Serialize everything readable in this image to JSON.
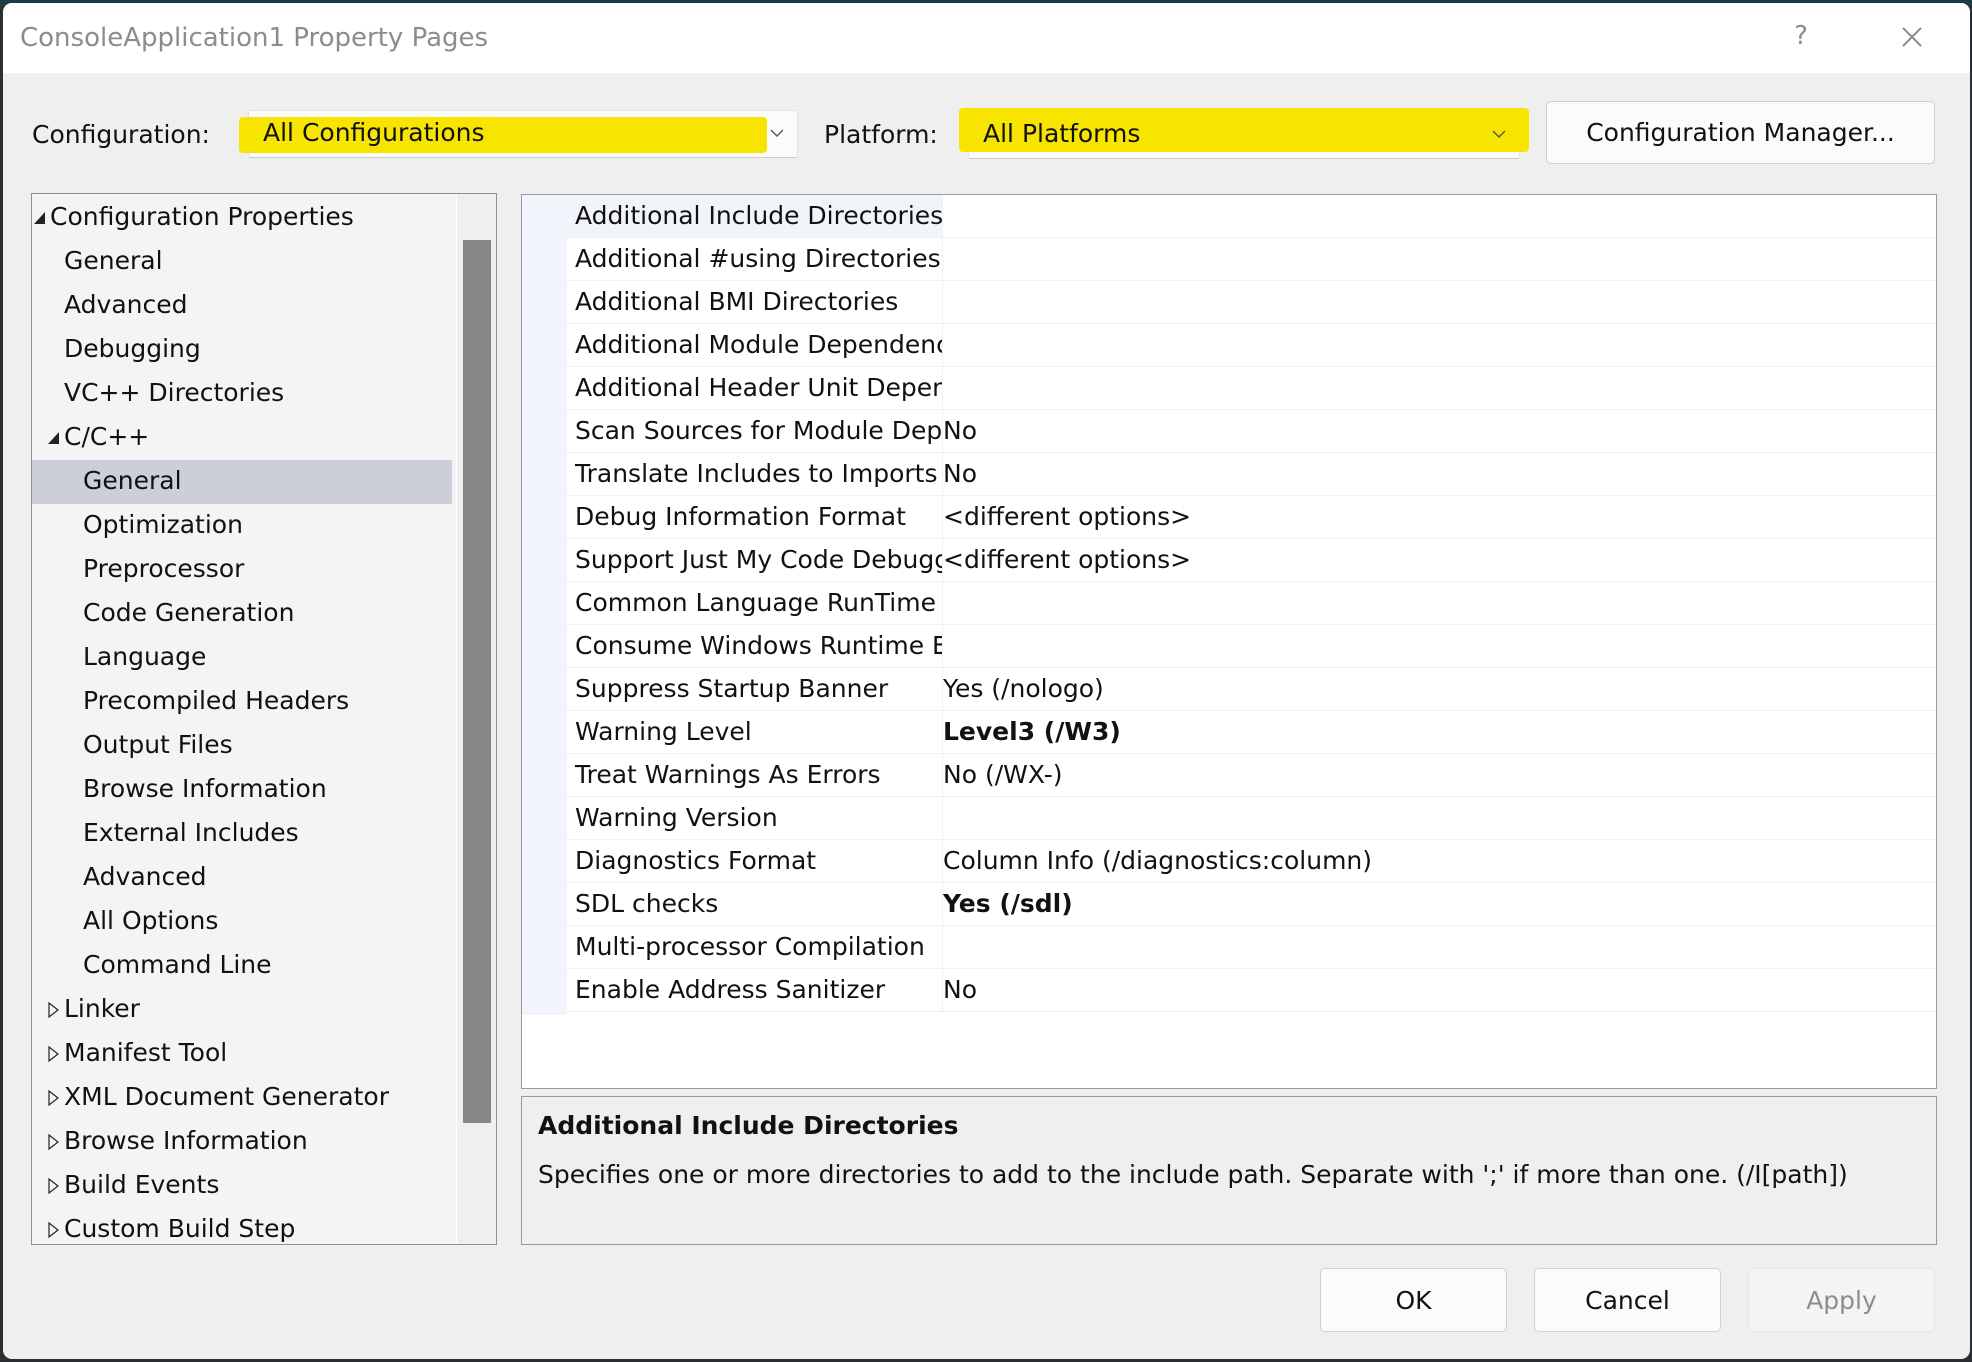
{
  "window": {
    "title": "ConsoleApplication1 Property Pages",
    "help_label": "?",
    "close_icon": "close-icon"
  },
  "config_bar": {
    "configuration_label": "Configuration:",
    "configuration_value": "All Configurations",
    "platform_label": "Platform:",
    "platform_value": "All Platforms",
    "config_manager_label": "Configuration Manager...",
    "highlight_color": "#f7e500"
  },
  "tree": {
    "items": [
      {
        "label": "Configuration Properties",
        "level": 0,
        "expander": "expanded"
      },
      {
        "label": "General",
        "level": 1,
        "expander": "none"
      },
      {
        "label": "Advanced",
        "level": 1,
        "expander": "none"
      },
      {
        "label": "Debugging",
        "level": 1,
        "expander": "none"
      },
      {
        "label": "VC++ Directories",
        "level": 1,
        "expander": "none"
      },
      {
        "label": "C/C++",
        "level": 1,
        "expander": "expanded"
      },
      {
        "label": "General",
        "level": 2,
        "expander": "none",
        "selected": true
      },
      {
        "label": "Optimization",
        "level": 2,
        "expander": "none"
      },
      {
        "label": "Preprocessor",
        "level": 2,
        "expander": "none"
      },
      {
        "label": "Code Generation",
        "level": 2,
        "expander": "none"
      },
      {
        "label": "Language",
        "level": 2,
        "expander": "none"
      },
      {
        "label": "Precompiled Headers",
        "level": 2,
        "expander": "none"
      },
      {
        "label": "Output Files",
        "level": 2,
        "expander": "none"
      },
      {
        "label": "Browse Information",
        "level": 2,
        "expander": "none"
      },
      {
        "label": "External Includes",
        "level": 2,
        "expander": "none"
      },
      {
        "label": "Advanced",
        "level": 2,
        "expander": "none"
      },
      {
        "label": "All Options",
        "level": 2,
        "expander": "none"
      },
      {
        "label": "Command Line",
        "level": 2,
        "expander": "none"
      },
      {
        "label": "Linker",
        "level": 1,
        "expander": "collapsed"
      },
      {
        "label": "Manifest Tool",
        "level": 1,
        "expander": "collapsed"
      },
      {
        "label": "XML Document Generator",
        "level": 1,
        "expander": "collapsed"
      },
      {
        "label": "Browse Information",
        "level": 1,
        "expander": "collapsed"
      },
      {
        "label": "Build Events",
        "level": 1,
        "expander": "collapsed"
      },
      {
        "label": "Custom Build Step",
        "level": 1,
        "expander": "collapsed"
      }
    ]
  },
  "properties": {
    "rows": [
      {
        "name": "Additional Include Directories",
        "value": "",
        "bold": false,
        "selected": true
      },
      {
        "name": "Additional #using Directories",
        "value": "",
        "bold": false
      },
      {
        "name": "Additional BMI Directories",
        "value": "",
        "bold": false
      },
      {
        "name": "Additional Module Dependencies",
        "value": "",
        "bold": false
      },
      {
        "name": "Additional Header Unit Dependencies",
        "value": "",
        "bold": false
      },
      {
        "name": "Scan Sources for Module Dependencies",
        "value": "No",
        "bold": false
      },
      {
        "name": "Translate Includes to Imports",
        "value": "No",
        "bold": false
      },
      {
        "name": "Debug Information Format",
        "value": "<different options>",
        "bold": false
      },
      {
        "name": "Support Just My Code Debugging",
        "value": "<different options>",
        "bold": false
      },
      {
        "name": "Common Language RunTime Support",
        "value": "",
        "bold": false
      },
      {
        "name": "Consume Windows Runtime Extension",
        "value": "",
        "bold": false
      },
      {
        "name": "Suppress Startup Banner",
        "value": "Yes (/nologo)",
        "bold": false
      },
      {
        "name": "Warning Level",
        "value": "Level3 (/W3)",
        "bold": true
      },
      {
        "name": "Treat Warnings As Errors",
        "value": "No (/WX-)",
        "bold": false
      },
      {
        "name": "Warning Version",
        "value": "",
        "bold": false
      },
      {
        "name": "Diagnostics Format",
        "value": "Column Info (/diagnostics:column)",
        "bold": false
      },
      {
        "name": "SDL checks",
        "value": "Yes (/sdl)",
        "bold": true
      },
      {
        "name": "Multi-processor Compilation",
        "value": "",
        "bold": false
      },
      {
        "name": "Enable Address Sanitizer",
        "value": "No",
        "bold": false
      }
    ]
  },
  "description": {
    "title": "Additional Include Directories",
    "text": "Specifies one or more directories to add to the include path. Separate with ';' if more than one. (/I[path])"
  },
  "buttons": {
    "ok": "OK",
    "cancel": "Cancel",
    "apply": "Apply"
  }
}
